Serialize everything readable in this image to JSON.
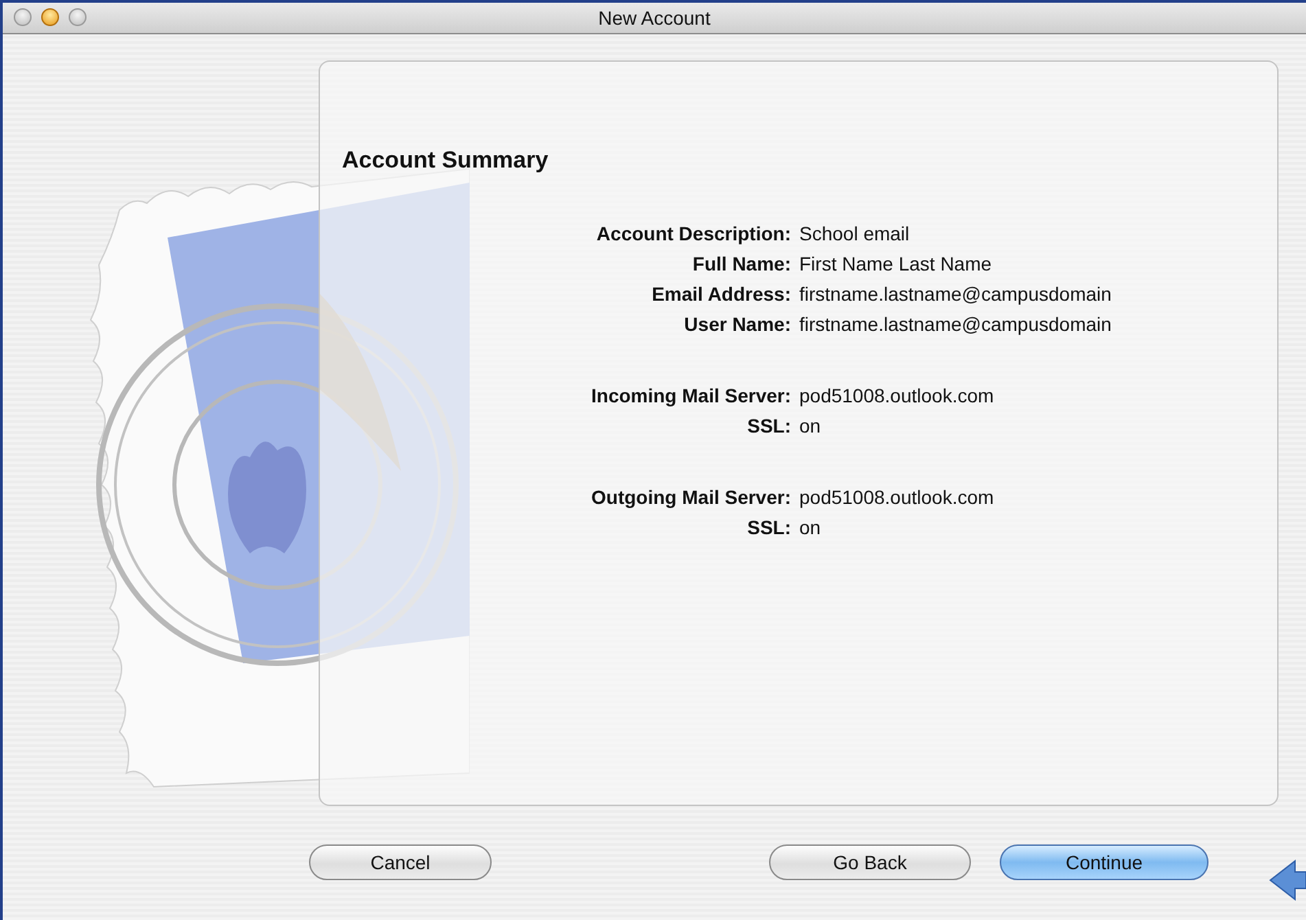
{
  "window": {
    "title": "New Account"
  },
  "summary": {
    "heading": "Account Summary",
    "sections": [
      [
        {
          "label": "Account Description:",
          "value": "School email"
        },
        {
          "label": "Full Name:",
          "value": "First Name Last Name"
        },
        {
          "label": "Email Address:",
          "value": "firstname.lastname@campusdomain"
        },
        {
          "label": "User Name:",
          "value": "firstname.lastname@campusdomain"
        }
      ],
      [
        {
          "label": "Incoming Mail Server:",
          "value": "pod51008.outlook.com"
        },
        {
          "label": "SSL:",
          "value": "on"
        }
      ],
      [
        {
          "label": "Outgoing Mail Server:",
          "value": "pod51008.outlook.com"
        },
        {
          "label": "SSL:",
          "value": "on"
        }
      ]
    ]
  },
  "buttons": [
    {
      "label": "Cancel",
      "kind": "normal"
    },
    {
      "label": "Go Back",
      "kind": "normal"
    },
    {
      "label": "Continue",
      "kind": "default"
    }
  ]
}
